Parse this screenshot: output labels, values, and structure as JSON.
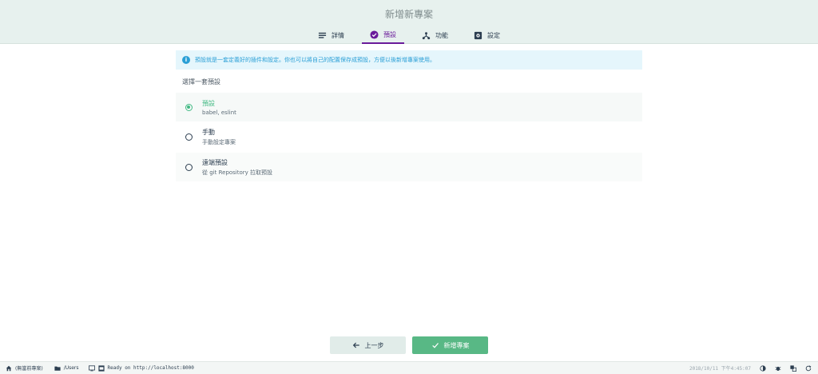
{
  "header": {
    "title": "新增新專案",
    "tabs": [
      {
        "label": "詳情",
        "icon": "details-icon",
        "active": false
      },
      {
        "label": "預設",
        "icon": "check-circle-icon",
        "active": true
      },
      {
        "label": "功能",
        "icon": "features-icon",
        "active": false
      },
      {
        "label": "設定",
        "icon": "settings-icon",
        "active": false
      }
    ]
  },
  "info": {
    "text": "預設就是一套定義好的插件和設定。你也可以將自己的配置保存成預設，方便以後新增專案使用。"
  },
  "presets": {
    "section_label": "選擇一套預設",
    "items": [
      {
        "name": "預設",
        "desc": "babel, eslint",
        "selected": true
      },
      {
        "name": "手動",
        "desc": "手動設定專案",
        "selected": false
      },
      {
        "name": "遠端預設",
        "desc": "從 git Repository 拉取預設",
        "selected": false
      }
    ]
  },
  "actions": {
    "prev_label": "上一步",
    "create_label": "新增專案"
  },
  "statusbar": {
    "project": "(無當前專案)",
    "folder": "/Users",
    "log": "Ready on http://localhost:8000",
    "time": "2018/10/11 下午4:45:07"
  },
  "colors": {
    "accent": "#42b983",
    "tab_active": "#6a1b9a",
    "info": "#2a9fd6"
  }
}
